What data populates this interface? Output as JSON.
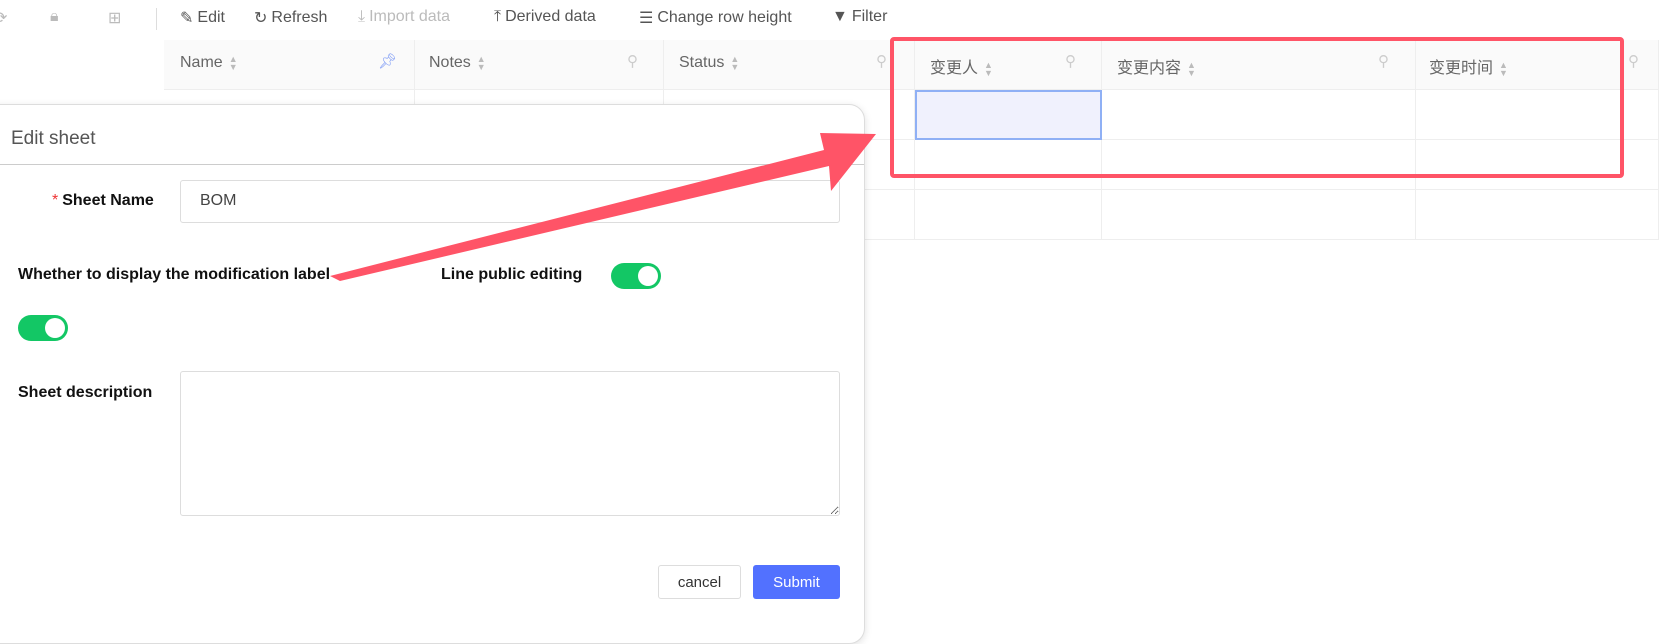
{
  "toolbar": {
    "edit": "Edit",
    "refresh": "Refresh",
    "import": "Import data",
    "derived": "Derived data",
    "row_height": "Change row height",
    "filter": "Filter"
  },
  "table": {
    "columns": [
      "Name",
      "Notes",
      "Status",
      "变更人",
      "变更内容",
      "变更时间"
    ]
  },
  "dialog": {
    "title": "Edit sheet",
    "sheet_name_label": "Sheet Name",
    "required_mark": "*",
    "sheet_name_value": "BOM",
    "mod_label": "Whether to display the modification label",
    "mod_label_on": true,
    "public_edit_label": "Line public editing",
    "public_edit_on": true,
    "desc_label": "Sheet description",
    "desc_value": "",
    "cancel": "cancel",
    "submit": "Submit"
  },
  "colors": {
    "accent": "#5271ff",
    "toggle_on": "#13c765",
    "annotation": "#ff5467",
    "selection": "#8fb0f5"
  }
}
